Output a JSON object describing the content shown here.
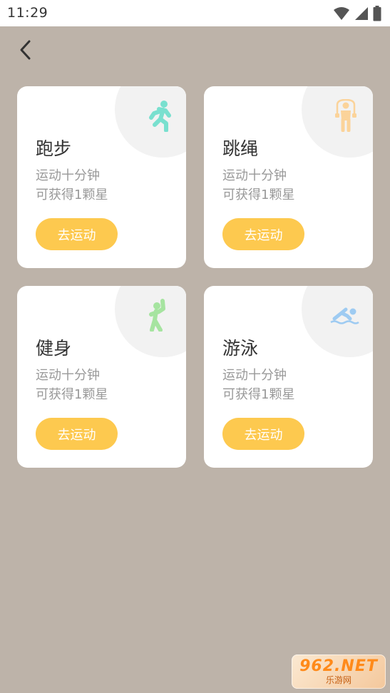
{
  "status_bar": {
    "time": "11:29"
  },
  "colors": {
    "background": "#bdb3a9",
    "card": "#ffffff",
    "button": "#fdc94f",
    "corner": "#f2f2f2"
  },
  "cards": [
    {
      "title": "跑步",
      "desc_line1": "运动十分钟",
      "desc_line2": "可获得1颗星",
      "button": "去运动",
      "icon": "running-icon",
      "icon_color": "#79e0cf"
    },
    {
      "title": "跳绳",
      "desc_line1": "运动十分钟",
      "desc_line2": "可获得1颗星",
      "button": "去运动",
      "icon": "jump-rope-icon",
      "icon_color": "#fbd39a"
    },
    {
      "title": "健身",
      "desc_line1": "运动十分钟",
      "desc_line2": "可获得1颗星",
      "button": "去运动",
      "icon": "fitness-icon",
      "icon_color": "#a6e4a0"
    },
    {
      "title": "游泳",
      "desc_line1": "运动十分钟",
      "desc_line2": "可获得1颗星",
      "button": "去运动",
      "icon": "swimming-icon",
      "icon_color": "#9ecbf2"
    }
  ],
  "watermark": {
    "logo": "962.NET",
    "sub": "乐游网"
  }
}
